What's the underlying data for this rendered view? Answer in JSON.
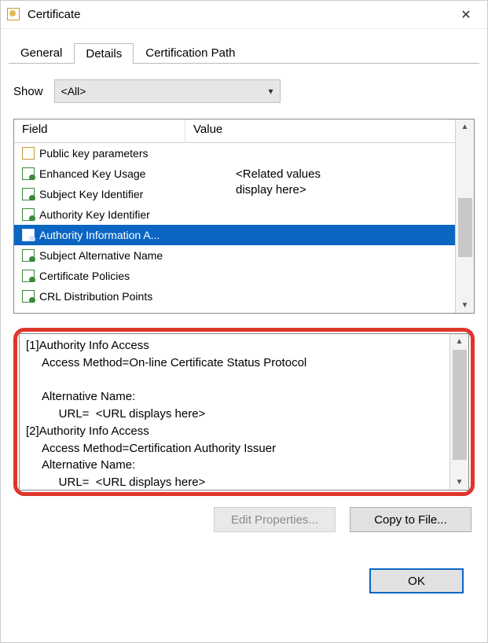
{
  "window": {
    "title": "Certificate"
  },
  "tabs": [
    "General",
    "Details",
    "Certification Path"
  ],
  "active_tab": 1,
  "show": {
    "label": "Show",
    "value": "<All>"
  },
  "columns": {
    "field": "Field",
    "value": "Value"
  },
  "value_note": "<Related values\ndisplay here>",
  "rows": [
    {
      "label": "Public key parameters",
      "icon": "sheet"
    },
    {
      "label": "Enhanced Key Usage",
      "icon": "ext"
    },
    {
      "label": "Subject Key Identifier",
      "icon": "ext"
    },
    {
      "label": "Authority Key Identifier",
      "icon": "ext"
    },
    {
      "label": "Authority Information A...",
      "icon": "ext",
      "selected": true
    },
    {
      "label": "Subject Alternative Name",
      "icon": "ext"
    },
    {
      "label": "Certificate Policies",
      "icon": "ext"
    },
    {
      "label": "CRL Distribution Points",
      "icon": "ext"
    }
  ],
  "detail_text": "[1]Authority Info Access\n     Access Method=On-line Certificate Status Protocol\n\n     Alternative Name:\n          URL=  <URL displays here>\n[2]Authority Info Access\n     Access Method=Certification Authority Issuer\n     Alternative Name:\n          URL=  <URL displays here>",
  "buttons": {
    "edit": "Edit Properties...",
    "copy": "Copy to File...",
    "ok": "OK"
  }
}
